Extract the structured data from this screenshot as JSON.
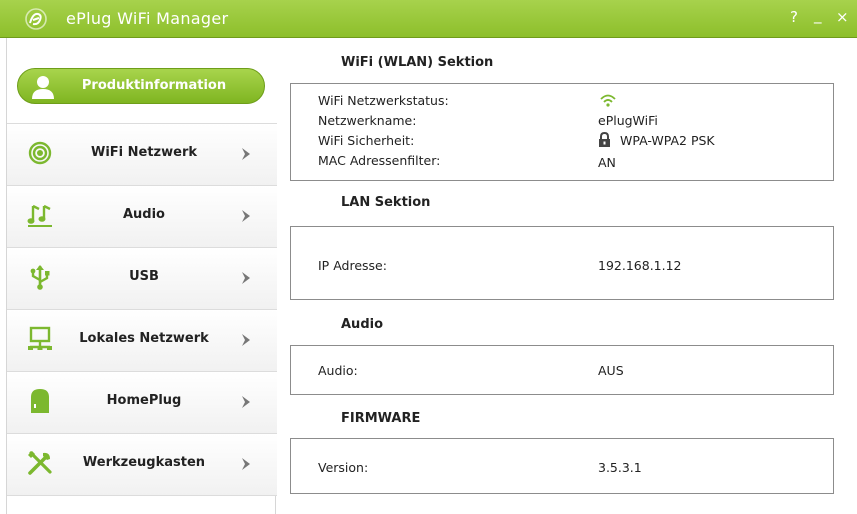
{
  "app": {
    "title": "ePlug WiFi Manager"
  },
  "window_controls": {
    "help": "?",
    "minimize": "_",
    "close": "×"
  },
  "sidebar": {
    "active": {
      "label": "Produktinformation",
      "icon": "user-icon"
    },
    "items": [
      {
        "label": "WiFi Netzwerk",
        "icon": "wifi-icon"
      },
      {
        "label": "Audio",
        "icon": "music-icon"
      },
      {
        "label": "USB",
        "icon": "usb-icon"
      },
      {
        "label": "Lokales Netzwerk",
        "icon": "network-icon"
      },
      {
        "label": "HomePlug",
        "icon": "homeplug-icon"
      },
      {
        "label": "Werkzeugkasten",
        "icon": "tools-icon"
      }
    ]
  },
  "sections": {
    "wifi": {
      "title": "WiFi (WLAN) Sektion",
      "rows": [
        {
          "label": "WiFi Netzwerkstatus:",
          "value": "",
          "icon": "wifi-status-icon"
        },
        {
          "label": "Netzwerkname:",
          "value": "ePlugWiFi"
        },
        {
          "label": "WiFi Sicherheit:",
          "value": "WPA-WPA2 PSK",
          "icon": "lock-icon"
        },
        {
          "label": "MAC Adressenfilter:",
          "value": "AN"
        }
      ]
    },
    "lan": {
      "title": "LAN Sektion",
      "label": "IP Adresse:",
      "value": "192.168.1.12"
    },
    "audio": {
      "title": "Audio",
      "label": "Audio:",
      "value": "AUS"
    },
    "firmware": {
      "title": "FIRMWARE",
      "label": "Version:",
      "value": "3.5.3.1"
    }
  },
  "colors": {
    "accent": "#8dbf2b",
    "accent_dark": "#6e9e1a",
    "icon_green": "#7cb82f"
  }
}
